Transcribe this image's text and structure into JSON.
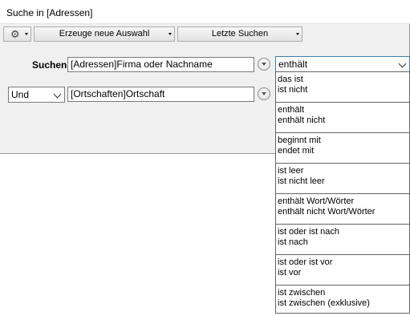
{
  "window": {
    "title": "Suche in [Adressen]"
  },
  "toolbar": {
    "settings_icon": "gear-icon",
    "new_selection_label": "Erzeuge neue Auswahl",
    "recent_searches_label": "Letzte Suchen"
  },
  "row1": {
    "label": "Suchen:",
    "field_value": "[Adressen]Firma oder Nachname",
    "operator": "enthält"
  },
  "row2": {
    "conjunction": "Und",
    "field_value": "[Ortschaften]Ortschaft"
  },
  "dropdown": {
    "options": [
      [
        "das ist",
        "ist nicht"
      ],
      [
        "enthält",
        "enthält nicht"
      ],
      [
        "beginnt mit",
        "endet mit"
      ],
      [
        "ist leer",
        "ist nicht leer"
      ],
      [
        "enthält Wort/Wörter",
        "enthält nicht Wort/Wörter"
      ],
      [
        "ist oder ist nach",
        "ist nach"
      ],
      [
        "ist oder ist vor",
        "ist vor"
      ],
      [
        "ist zwischen",
        "ist zwischen (exklusive)"
      ]
    ]
  },
  "colors": {
    "active_border": "#3c7fb1",
    "window_bg": "#f0f0f0"
  }
}
